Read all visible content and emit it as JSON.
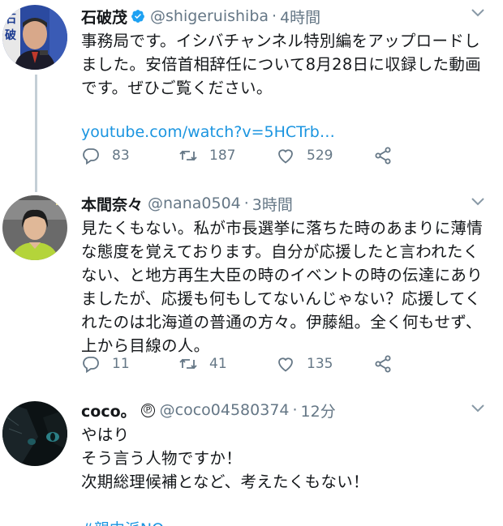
{
  "tweets": [
    {
      "name": "石破茂",
      "handle": "@shigeruishiba",
      "time": "4時間",
      "verified": true,
      "text": "事務局です。イシバチャンネル特別編をアップロードし\nました。安倍首相辞任について8月28日に収録した動画\nです。ぜひご覧ください。",
      "link": "youtube.com/watch?v=5HCTrb…",
      "replies": "83",
      "retweets": "187",
      "likes": "529"
    },
    {
      "name": "本間奈々",
      "handle": "@nana0504",
      "time": "3時間",
      "text": "見たくもない。私が市長選挙に落ちた時のあまりに薄情\nな態度を覚えております。自分が応援したと言われたく\nない、と地方再生大臣の時のイベントの時の伝達にあり\nましたが、応援も何もしてないんじゃない？応援してく\nれたのは北海道の普通の方々。伊藤組。全く何もせず、\n上から目線の人。",
      "replies": "11",
      "retweets": "41",
      "likes": "135"
    },
    {
      "name": "coco。",
      "badge": "℗",
      "handle": "@coco04580374",
      "time": "12分",
      "text": "やはり\nそう言う人物ですか！\n次期総理候補となど、考えたくもない！",
      "hashtag": "#親中派NO"
    }
  ],
  "colors": {
    "link": "#1b95e0",
    "secondary": "#657786",
    "thread_line": "#c4cfd6",
    "verified": "#1da1f2"
  },
  "icons": [
    "verified-icon",
    "chevron-down-icon",
    "reply-icon",
    "retweet-icon",
    "like-icon",
    "share-icon"
  ]
}
